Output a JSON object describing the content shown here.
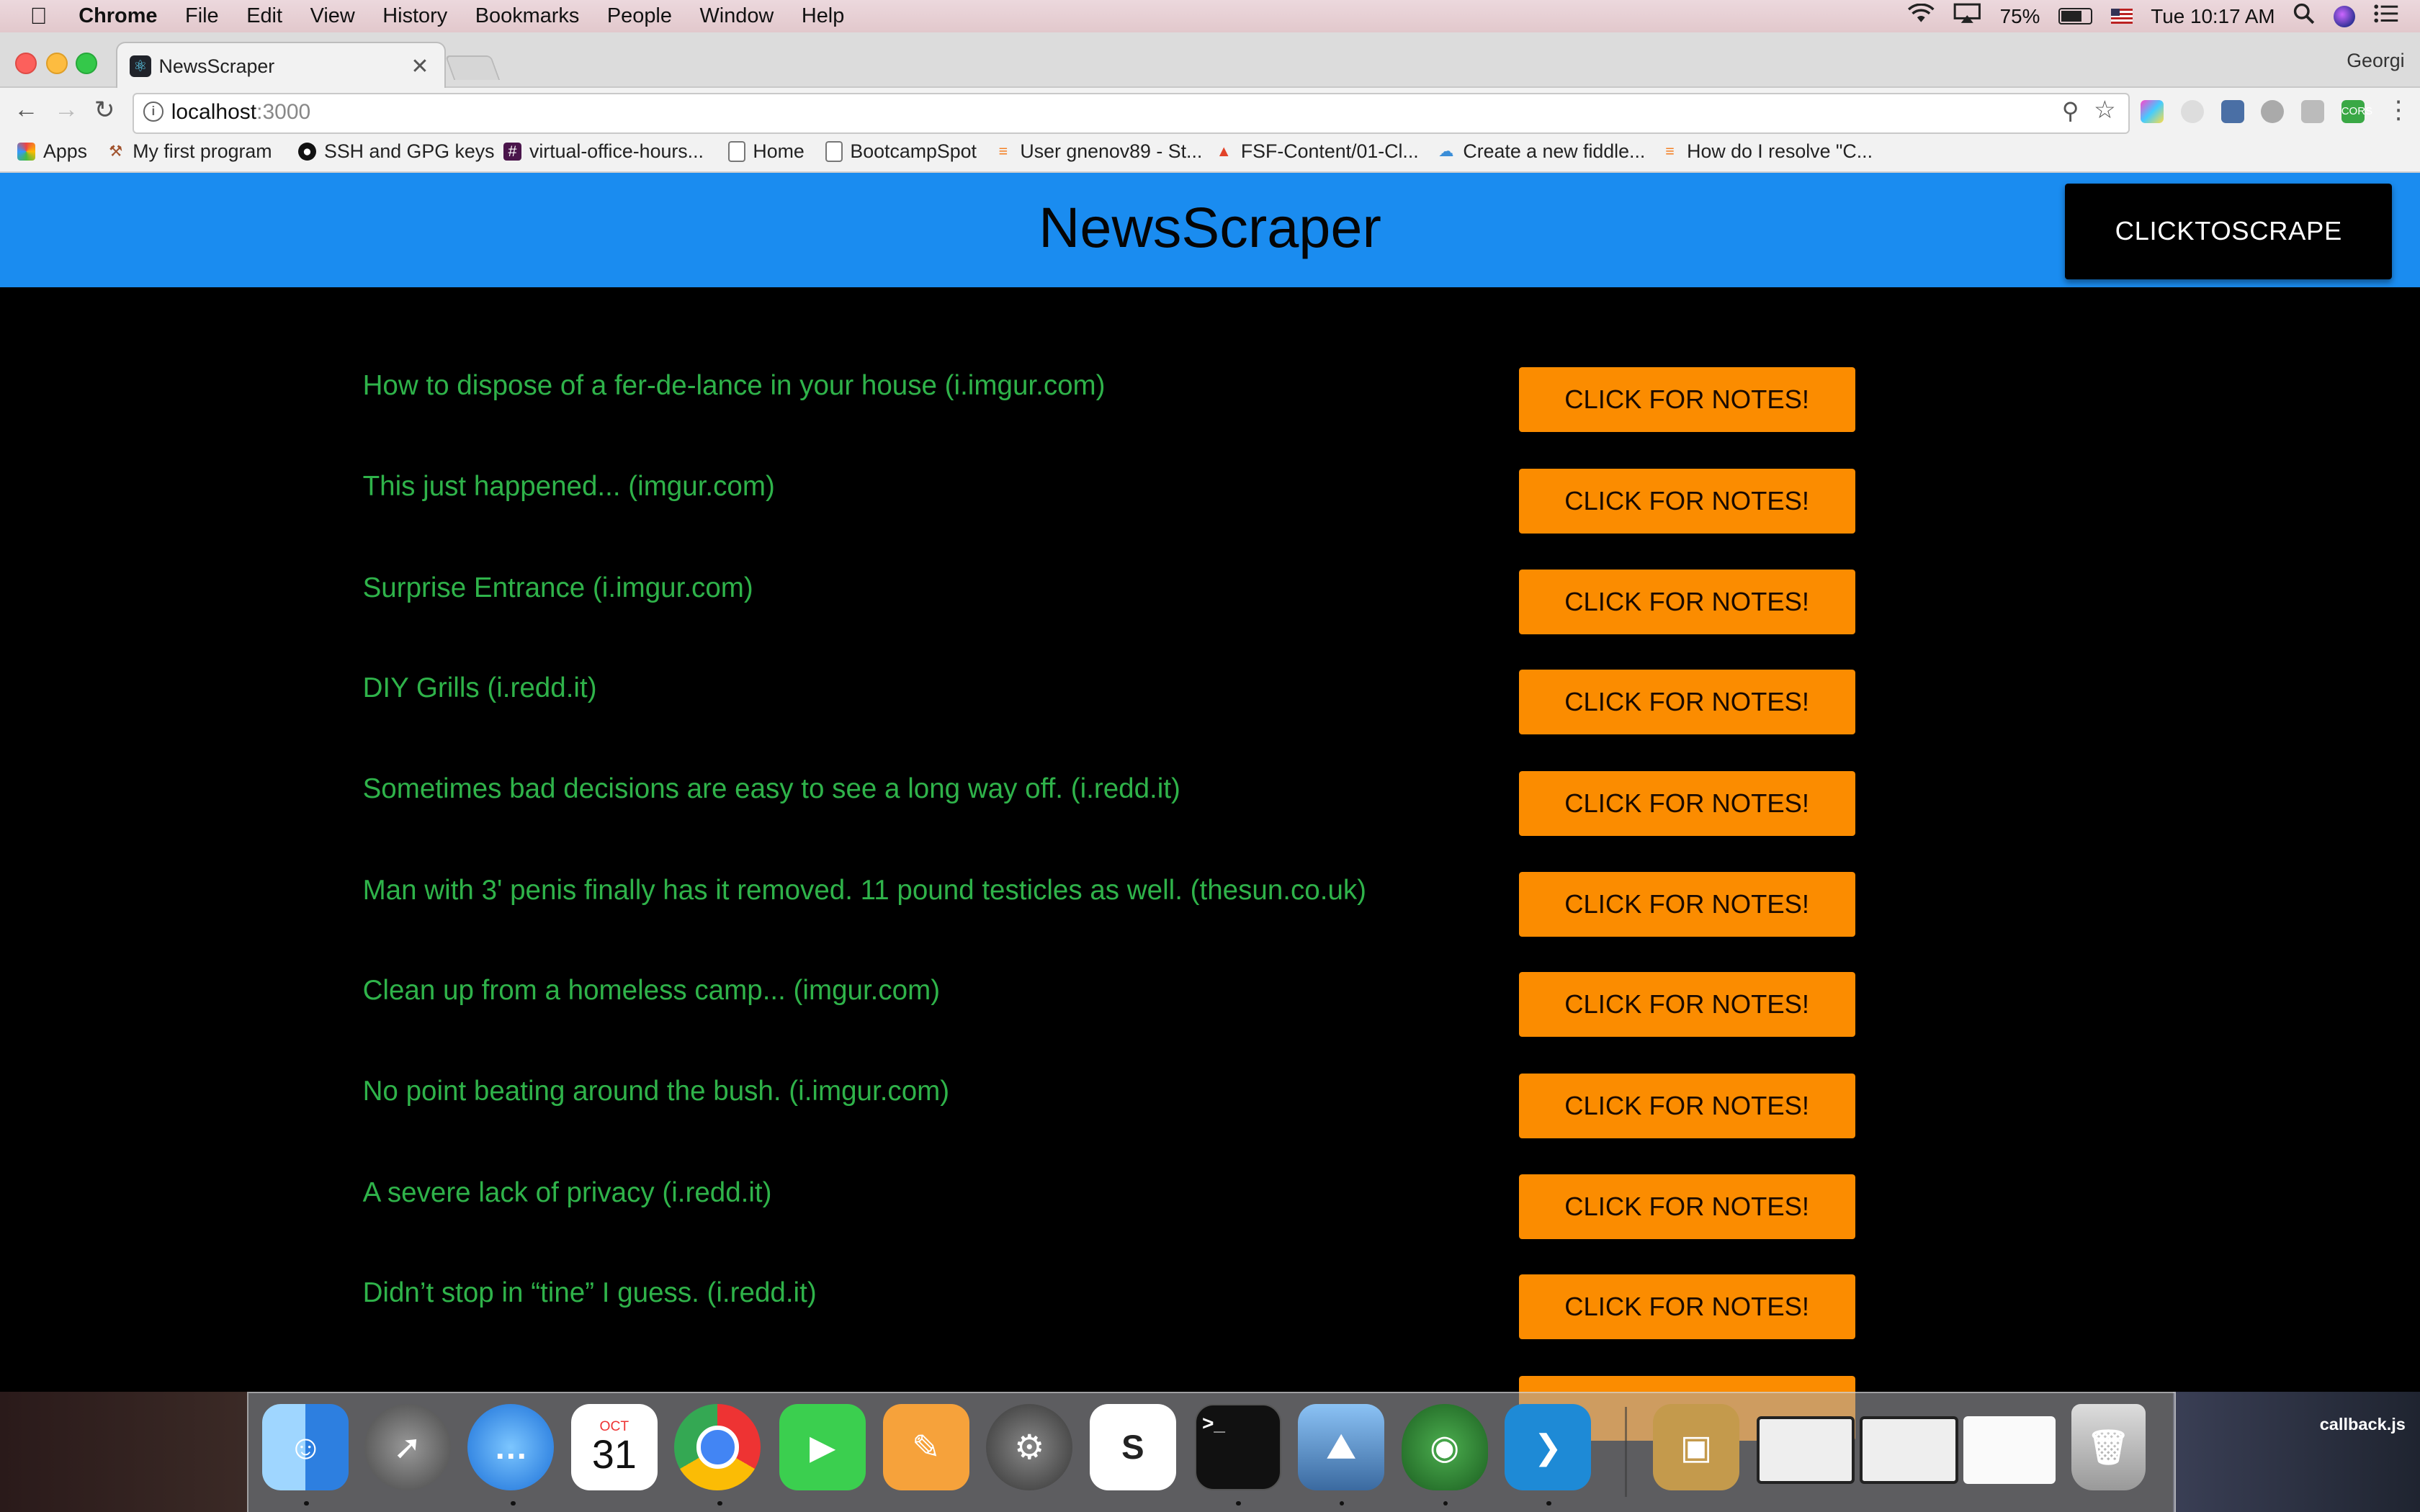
{
  "menubar": {
    "app": "Chrome",
    "items": [
      "File",
      "Edit",
      "View",
      "History",
      "Bookmarks",
      "People",
      "Window",
      "Help"
    ],
    "battery": "75%",
    "clock": "Tue 10:17 AM"
  },
  "browser": {
    "tab_title": "NewsScraper",
    "profile": "Georgi",
    "url_host": "localhost",
    "url_port": ":3000",
    "bookmarks": [
      "Apps",
      "My first program",
      "SSH and GPG keys",
      "virtual-office-hours...",
      "Home",
      "BootcampSpot",
      "User gnenov89 - St...",
      "FSF-Content/01-Cl...",
      "Create a new fiddle...",
      "How do I resolve \"C..."
    ]
  },
  "page": {
    "title": "NewsScraper",
    "scrape_button": "CLICKTOSCRAPE",
    "notes_button": "Click for Notes!",
    "articles": [
      "How to dispose of a fer-de-lance in your house (i.imgur.com)",
      "This just happened... (imgur.com)",
      "Surprise Entrance (i.imgur.com)",
      "DIY Grills (i.redd.it)",
      "Sometimes bad decisions are easy to see a long way off. (i.redd.it)",
      "Man with 3' penis finally has it removed. 11 pound testicles as well. (thesun.co.uk)",
      "Clean up from a homeless camp... (imgur.com)",
      "No point beating around the bush. (i.imgur.com)",
      "A severe lack of privacy (i.redd.it)",
      "Didn’t stop in “tine” I guess. (i.redd.it)"
    ]
  },
  "dock": {
    "calendar_month": "OCT",
    "calendar_day": "31",
    "desktop_file": "callback.js",
    "apps": [
      "finder-icon",
      "launchpad-icon",
      "messages-icon",
      "calendar-icon",
      "chrome-icon",
      "facetime-icon",
      "pages-icon",
      "system-preferences-icon",
      "slack-icon",
      "terminal-icon",
      "preview-icon",
      "gitkraken-icon",
      "vscode-icon",
      "archive-icon",
      "window-thumbnail-icon",
      "window-thumbnail-icon",
      "window-thumbnail-icon",
      "trash-icon"
    ]
  },
  "colors": {
    "header": "#1a8cf0",
    "notes_button": "#fb8c00",
    "article_text": "#2fb34a"
  }
}
